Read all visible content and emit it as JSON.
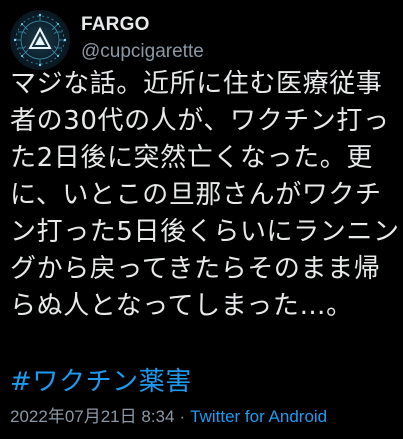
{
  "user": {
    "display_name": "FARGO",
    "handle": "@cupcigarette",
    "avatar_icon": "circuit-emblem-avatar"
  },
  "tweet": {
    "text": "マジな話。近所に住む医療従事者の30代の人が、ワクチン打った2日後に突然亡くなった。更に、いとこの旦那さんがワクチン打った5日後くらいにランニングから戻ってきたらそのまま帰らぬ人となってしまった…。",
    "hashtag": "#ワクチン薬害",
    "timestamp": "2022年07月21日 8:34",
    "separator": "·",
    "source": "Twitter for Android"
  },
  "colors": {
    "background": "#000000",
    "text": "#e7e9ea",
    "secondary": "#8b98a5",
    "link": "#1d9bf0"
  }
}
